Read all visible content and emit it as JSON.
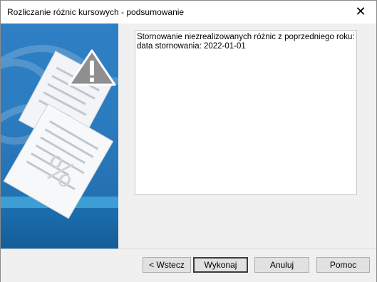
{
  "window": {
    "title": "Rozliczanie różnic kursowych - podsumowanie",
    "close_glyph": "✕"
  },
  "info": {
    "line1": "Stornowanie niezrealizowanych różnic z poprzedniego roku:",
    "line2": "data stornowania: 2022-01-01"
  },
  "buttons": {
    "back": "< Wstecz",
    "execute": "Wykonaj",
    "cancel": "Anuluj",
    "help": "Pomoc"
  },
  "colors": {
    "side_panel": "#2c7cc0",
    "accent_band": "#3fa3d9",
    "warning_triangle": "#8f8f8f"
  },
  "icons": [
    "warning-icon",
    "documents-illustration",
    "close-icon"
  ]
}
